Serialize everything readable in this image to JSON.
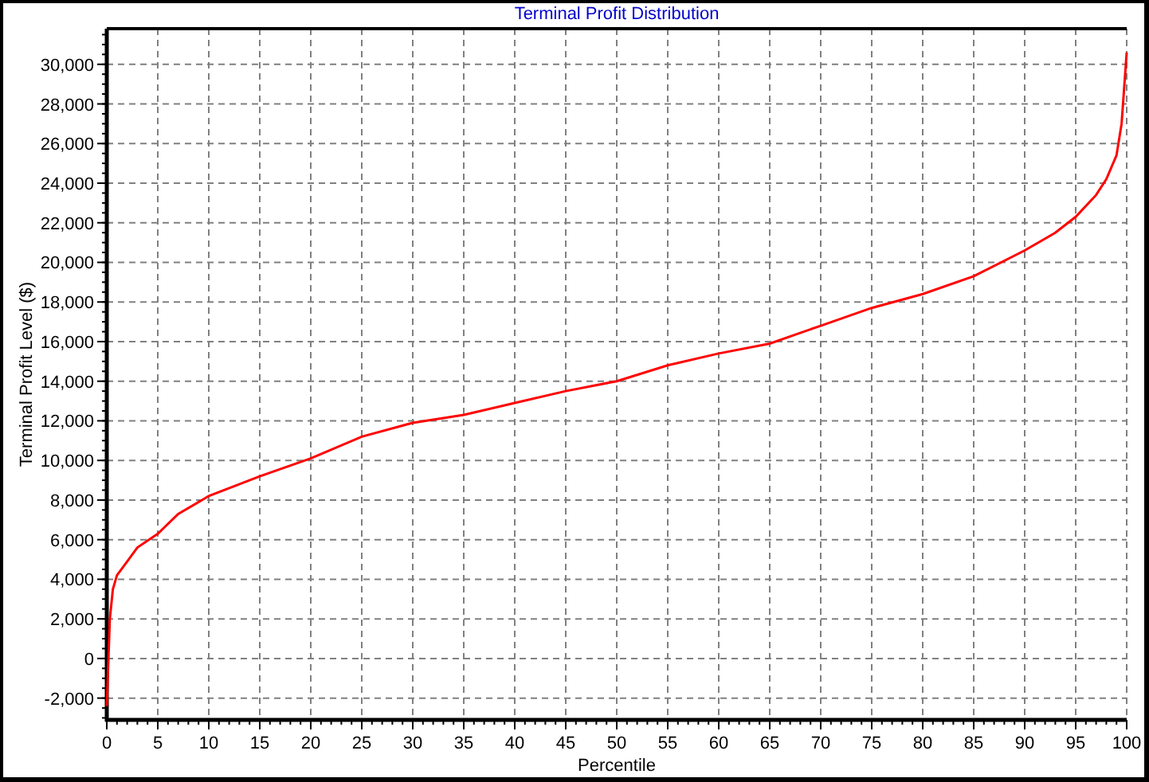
{
  "chart_data": {
    "type": "line",
    "title": "Terminal Profit Distribution",
    "xlabel": "Percentile",
    "ylabel": "Terminal Profit Level ($)",
    "x": [
      0,
      0.3,
      0.6,
      1,
      2,
      3,
      5,
      7,
      10,
      15,
      20,
      25,
      30,
      35,
      40,
      45,
      50,
      55,
      60,
      65,
      70,
      75,
      80,
      85,
      90,
      93,
      95,
      97,
      98,
      99,
      99.5,
      100
    ],
    "grid": true,
    "series": [
      {
        "color": "#ff0000",
        "values": [
          -2400,
          2000,
          3500,
          4200,
          4900,
          5600,
          6300,
          7300,
          8200,
          9200,
          10100,
          11200,
          11900,
          12300,
          12900,
          13500,
          14000,
          14800,
          15400,
          15900,
          16800,
          17700,
          18400,
          19300,
          20600,
          21500,
          22300,
          23400,
          24200,
          25400,
          27000,
          30600
        ]
      }
    ],
    "xlim": [
      0,
      100
    ],
    "ylim": [
      -3100,
      31800
    ],
    "xticks": [
      0,
      5,
      10,
      15,
      20,
      25,
      30,
      35,
      40,
      45,
      50,
      55,
      60,
      65,
      70,
      75,
      80,
      85,
      90,
      95,
      100
    ],
    "yticks": [
      {
        "value": -2000,
        "label": "-2,000"
      },
      {
        "value": 0,
        "label": "0"
      },
      {
        "value": 2000,
        "label": "2,000"
      },
      {
        "value": 4000,
        "label": "4,000"
      },
      {
        "value": 6000,
        "label": "6,000"
      },
      {
        "value": 8000,
        "label": "8,000"
      },
      {
        "value": 10000,
        "label": "10,000"
      },
      {
        "value": 12000,
        "label": "12,000"
      },
      {
        "value": 14000,
        "label": "14,000"
      },
      {
        "value": 16000,
        "label": "16,000"
      },
      {
        "value": 18000,
        "label": "18,000"
      },
      {
        "value": 20000,
        "label": "20,000"
      },
      {
        "value": 22000,
        "label": "22,000"
      },
      {
        "value": 24000,
        "label": "24,000"
      },
      {
        "value": 26000,
        "label": "26,000"
      },
      {
        "value": 28000,
        "label": "28,000"
      },
      {
        "value": 30000,
        "label": "30,000"
      }
    ]
  }
}
